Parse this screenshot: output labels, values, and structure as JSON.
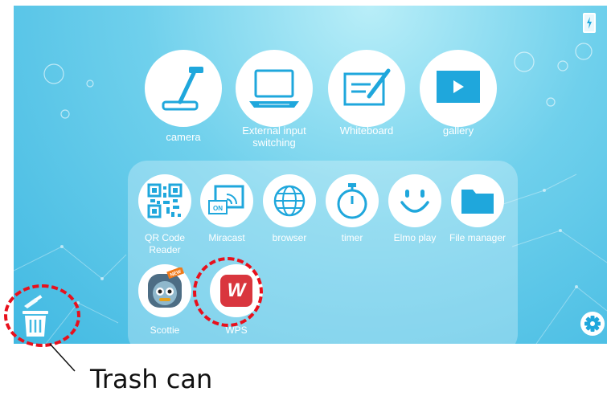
{
  "apps": {
    "camera": "camera",
    "external_input": "External input switching",
    "whiteboard": "Whiteboard",
    "gallery": "gallery"
  },
  "small_apps": {
    "qr_reader": "QR Code Reader",
    "miracast": "Miracast",
    "browser": "browser",
    "timer": "timer",
    "elmo_play": "Elmo play",
    "file_manager": "File manager",
    "scottie": "Scottie",
    "wps_office": "WPS"
  },
  "icons": {
    "miracast_badge": "ON",
    "wps_letter": "W",
    "scottie_badge": "NEW"
  },
  "annotation": {
    "caption": "Trash can"
  },
  "colors": {
    "accent_blue": "#1fa7dc",
    "highlight_red": "#e8101c",
    "wps_red": "#d9363e"
  }
}
